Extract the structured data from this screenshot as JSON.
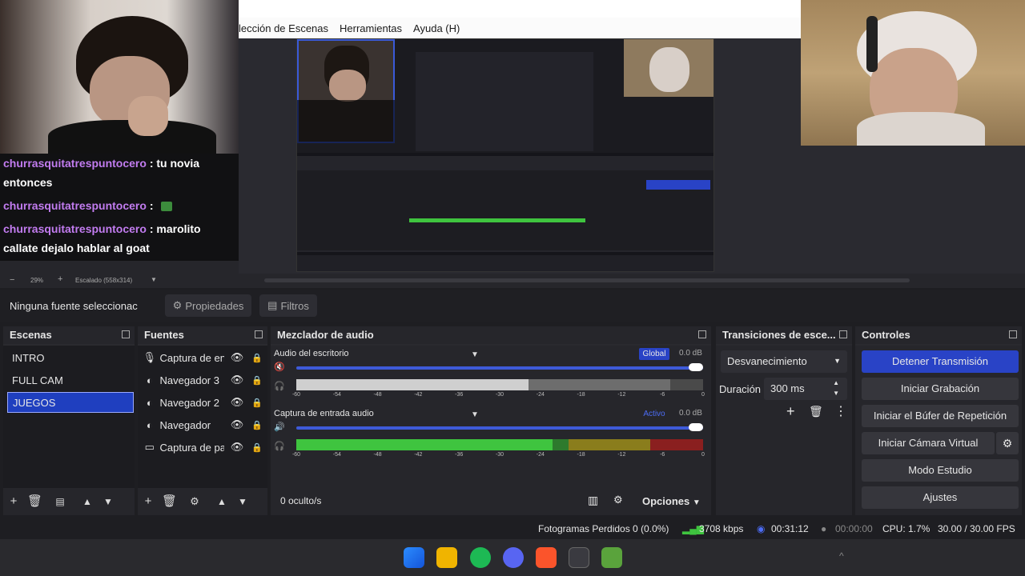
{
  "menubar": {
    "items": [
      "lección de Escenas",
      "Herramientas",
      "Ayuda (H)"
    ]
  },
  "chat": {
    "messages": [
      {
        "user": "churrasquitatrespuntocero",
        "text": ": tu novia entonces"
      },
      {
        "user": "churrasquitatrespuntocero",
        "text": ":"
      },
      {
        "user": "churrasquitatrespuntocero",
        "text": ": marolito callate dejalo hablar al goat"
      }
    ]
  },
  "zoombar": {
    "zoom": "29%",
    "scale": "Escalado (558x314)"
  },
  "source_toolbar": {
    "no_source": "Ninguna fuente seleccionac",
    "properties": "Propiedades",
    "filters": "Filtros"
  },
  "scenes": {
    "title": "Escenas",
    "items": [
      {
        "label": "INTRO"
      },
      {
        "label": "FULL CAM"
      },
      {
        "label": "JUEGOS"
      }
    ]
  },
  "sources": {
    "title": "Fuentes",
    "items": [
      {
        "label": "Captura de en",
        "icon": "microphone-icon"
      },
      {
        "label": "Navegador 3",
        "icon": "globe-icon"
      },
      {
        "label": "Navegador 2",
        "icon": "globe-icon"
      },
      {
        "label": "Navegador",
        "icon": "globe-icon"
      },
      {
        "label": "Captura de pa",
        "icon": "monitor-icon"
      }
    ]
  },
  "mixer": {
    "title": "Mezclador de audio",
    "channels": [
      {
        "name": "Audio del escritorio",
        "badge": "Global",
        "db": "0.0 dB",
        "level": 0.57
      },
      {
        "name": "Captura de entrada audio",
        "badge": "Activo",
        "db": "0.0 dB",
        "level": 0.63
      }
    ],
    "scale": [
      "-60",
      "-54",
      "-48",
      "-42",
      "-36",
      "-30",
      "-24",
      "-18",
      "-12",
      "-6",
      "0"
    ],
    "hidden": "0 oculto/s",
    "options": "Opciones"
  },
  "transitions": {
    "title": "Transiciones de esce...",
    "selected": "Desvanecimiento",
    "duration_label": "Duración",
    "duration_value": "300 ms"
  },
  "controls": {
    "title": "Controles",
    "buttons": [
      "Detener Transmisión",
      "Iniciar Grabación",
      "Iniciar el Búfer de Repetición",
      "Iniciar Cámara Virtual",
      "Modo Estudio",
      "Ajustes"
    ]
  },
  "status": {
    "dropped": "Fotogramas Perdidos 0 (0.0%)",
    "bitrate": "3708 kbps",
    "stream_time": "00:31:12",
    "rec_time": "00:00:00",
    "cpu": "CPU: 1.7%",
    "fps": "30.00 / 30.00 FPS"
  },
  "colors": {
    "accent": "#2943c6",
    "chat_user": "#c27cf0",
    "meter_green": "#3fc43f",
    "meter_yellow": "#c9b92a",
    "meter_red": "#c22b2b"
  }
}
